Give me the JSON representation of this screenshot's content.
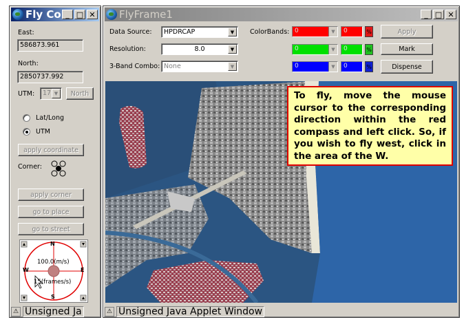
{
  "control_window": {
    "title": "Fly Co...",
    "east_label": "East:",
    "east_value": "586873.961",
    "north_label": "North:",
    "north_value": "2850737.992",
    "utm_label": "UTM:",
    "utm_zone": "17",
    "north_button": "North",
    "radio_latlong": "Lat/Long",
    "radio_utm": "UTM",
    "selected_radio": "UTM",
    "apply_coordinate": "apply coordinate",
    "corner_label": "Corner:",
    "apply_corner": "apply corner",
    "go_to_place": "go to place",
    "go_to_street": "go to street",
    "compass": {
      "n": "N",
      "s": "S",
      "e": "E",
      "w": "W",
      "speed": "100.0(m/s)",
      "frames": "15(frames/s)"
    },
    "status": "Unsigned Ja"
  },
  "fly_frame": {
    "title": "FlyFrame1",
    "data_source_label": "Data Source:",
    "data_source_value": "HPDRCAP",
    "resolution_label": "Resolution:",
    "resolution_value": "8.0",
    "band_combo_label": "3-Band Combo:",
    "band_combo_value": "None",
    "colorbands_label": "ColorBands:",
    "bands": [
      {
        "color": "#ff0000",
        "value": "0",
        "value2": "0",
        "indicator": "%",
        "ind_color": "#e01818"
      },
      {
        "color": "#00e000",
        "value": "0",
        "value2": "0",
        "indicator": "%",
        "ind_color": "#20c020"
      },
      {
        "color": "#0000ff",
        "value": "0",
        "value2": "0",
        "indicator": "%",
        "ind_color": "#1020d0"
      }
    ],
    "apply_button": "Apply",
    "mark_button": "Mark",
    "dispense_button": "Dispense",
    "status": "Unsigned Java Applet Window"
  },
  "callout_text": "To fly, move the mouse cursor to the corresponding direction within the red compass and left click. So, if you wish to fly west, click in the area of the W.",
  "icons": {
    "minimize": "minimize-icon",
    "maximize": "maximize-icon",
    "close": "close-icon",
    "warning": "java-applet-warning-icon",
    "app": "globe-icon"
  },
  "colors": {
    "active_title": "#0a246a",
    "inactive_title": "#808080",
    "compass_red": "#e00000",
    "callout_bg": "#ffffa8"
  }
}
